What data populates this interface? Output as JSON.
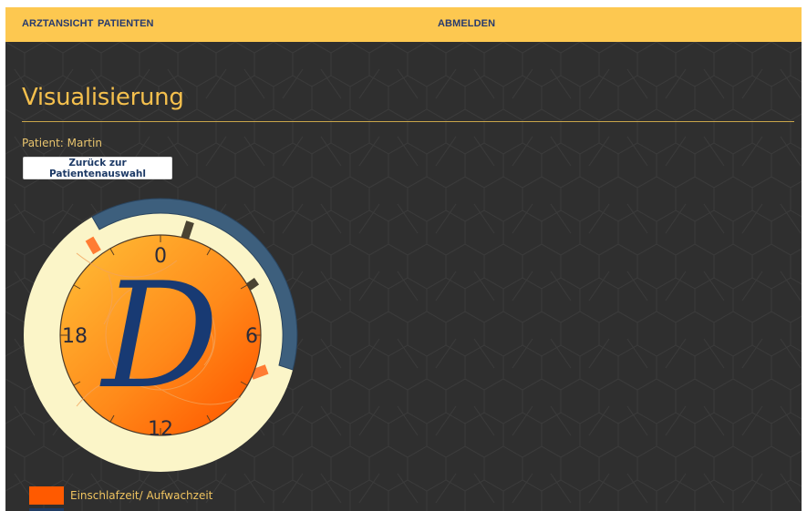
{
  "nav": {
    "doctor_view": "ARZTANSICHT",
    "patients": "PATIENTEN",
    "logout": "ABMELDEN"
  },
  "page": {
    "title": "Visualisierung",
    "patient": "Patient: Martin",
    "back_button": "Zurück zur Patientenauswahl"
  },
  "clock": {
    "labels": {
      "top": "0",
      "right": "6",
      "bottom": "12",
      "left": "18"
    },
    "logo_letter": "D"
  },
  "legend": {
    "items": [
      {
        "label": "Einschlafzeit/ Aufwachzeit",
        "color": "#ff5a00"
      }
    ]
  },
  "colors": {
    "navbar": "#fdc850",
    "background": "#2f2f2f",
    "accent": "#f5c04d",
    "ring_outer": "#fbf5c8",
    "ring_blue": "#3d5f7d",
    "marker_orange": "#ff7c33",
    "marker_dark": "#4a4332",
    "logo": "#183a73"
  },
  "icons": {
    "clock": "sleep-clock-chart"
  }
}
